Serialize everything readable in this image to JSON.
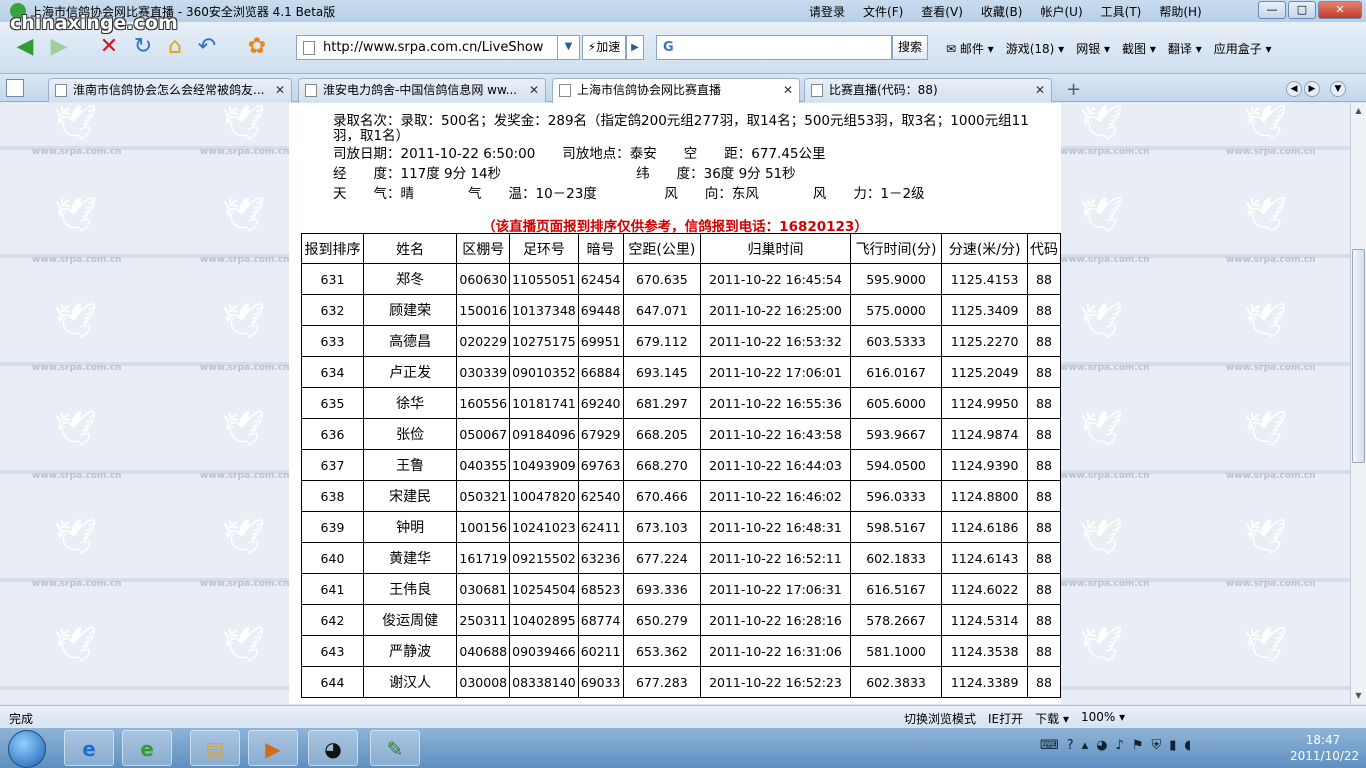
{
  "window": {
    "title": "上海市信鸽协会网比赛直播 - 360安全浏览器 4.1 Beta版",
    "watermark": "chinaxinge.com",
    "menu": [
      "请登录",
      "文件(F)",
      "查看(V)",
      "收藏(B)",
      "帐户(U)",
      "工具(T)",
      "帮助(H)"
    ],
    "controls": {
      "minimize": "—",
      "maximize": "□",
      "close": "✕"
    }
  },
  "navbar": {
    "url": "http://www.srpa.com.cn/LiveShow",
    "speed_label": "⚡加速",
    "search_placeholder": "",
    "search_button": "搜索",
    "search_logo": "G",
    "tools": [
      "✉ 邮件 ▾",
      "游戏(18) ▾",
      "网银 ▾",
      "截图 ▾",
      "翻译 ▾",
      "应用盒子 ▾"
    ]
  },
  "tabs": [
    {
      "label": "淮南市信鸽协会怎么会经常被鸽友...",
      "close": "✕"
    },
    {
      "label": "淮安电力鸽舍-中国信鸽信息网 ww...",
      "close": "✕"
    },
    {
      "label": "上海市信鸽协会网比赛直播",
      "close": "✕"
    },
    {
      "label": "比赛直播(代码：88)",
      "close": "✕"
    }
  ],
  "race_info": {
    "line1": "录取名次：录取：500名；发奖金：289名（指定鸽200元组277羽，取14名；500元组53羽，取3名；1000元组11",
    "line2": "羽，取1名）",
    "line3": "司放日期：2011-10-22 6:50:00　　司放地点：泰安　　空　　距：677.45公里",
    "line4": "经　　度：117度 9分 14秒　　　　　　　　　　纬　　度：36度 9分 51秒",
    "line5": "天　　气：晴　　　　气　　温：10－23度　　　　　风　　向：东风　　　　风　　力：1－2级",
    "notice": "（该直播页面报到排序仅供参考，信鸽报到电话：16820123）"
  },
  "table": {
    "headers": [
      "报到排序",
      "姓名",
      "区棚号",
      "足环号",
      "暗号",
      "空距(公里)",
      "归巢时间",
      "飞行时间(分)",
      "分速(米/分)",
      "代码"
    ],
    "rows": [
      [
        "631",
        "郑冬",
        "060630",
        "11055051",
        "62454",
        "670.635",
        "2011-10-22 16:45:54",
        "595.9000",
        "1125.4153",
        "88"
      ],
      [
        "632",
        "顾建荣",
        "150016",
        "10137348",
        "69448",
        "647.071",
        "2011-10-22 16:25:00",
        "575.0000",
        "1125.3409",
        "88"
      ],
      [
        "633",
        "高德昌",
        "020229",
        "10275175",
        "69951",
        "679.112",
        "2011-10-22 16:53:32",
        "603.5333",
        "1125.2270",
        "88"
      ],
      [
        "634",
        "卢正发",
        "030339",
        "09010352",
        "66884",
        "693.145",
        "2011-10-22 17:06:01",
        "616.0167",
        "1125.2049",
        "88"
      ],
      [
        "635",
        "徐华",
        "160556",
        "10181741",
        "69240",
        "681.297",
        "2011-10-22 16:55:36",
        "605.6000",
        "1124.9950",
        "88"
      ],
      [
        "636",
        "张俭",
        "050067",
        "09184096",
        "67929",
        "668.205",
        "2011-10-22 16:43:58",
        "593.9667",
        "1124.9874",
        "88"
      ],
      [
        "637",
        "王鲁",
        "040355",
        "10493909",
        "69763",
        "668.270",
        "2011-10-22 16:44:03",
        "594.0500",
        "1124.9390",
        "88"
      ],
      [
        "638",
        "宋建民",
        "050321",
        "10047820",
        "62540",
        "670.466",
        "2011-10-22 16:46:02",
        "596.0333",
        "1124.8800",
        "88"
      ],
      [
        "639",
        "钟明",
        "100156",
        "10241023",
        "62411",
        "673.103",
        "2011-10-22 16:48:31",
        "598.5167",
        "1124.6186",
        "88"
      ],
      [
        "640",
        "黄建华",
        "161719",
        "09215502",
        "63236",
        "677.224",
        "2011-10-22 16:52:11",
        "602.1833",
        "1124.6143",
        "88"
      ],
      [
        "641",
        "王伟良",
        "030681",
        "10254504",
        "68523",
        "693.336",
        "2011-10-22 17:06:31",
        "616.5167",
        "1124.6022",
        "88"
      ],
      [
        "642",
        "俊运周健",
        "250311",
        "10402895",
        "68774",
        "650.279",
        "2011-10-22 16:28:16",
        "578.2667",
        "1124.5314",
        "88"
      ],
      [
        "643",
        "严静波",
        "040688",
        "09039466",
        "60211",
        "653.362",
        "2011-10-22 16:31:06",
        "581.1000",
        "1124.3538",
        "88"
      ],
      [
        "644",
        "谢汉人",
        "030008",
        "08338140",
        "69033",
        "677.283",
        "2011-10-22 16:52:23",
        "602.3833",
        "1124.3389",
        "88"
      ]
    ]
  },
  "background": {
    "site_text": "www.srpa.com.cn"
  },
  "statusbar": {
    "status": "完成",
    "items": [
      "切换浏览模式",
      "IE打开",
      "下载 ▾",
      "100% ▾"
    ]
  },
  "taskbar": {
    "tray_text": "",
    "time": "18:47",
    "date": "2011/10/22"
  }
}
